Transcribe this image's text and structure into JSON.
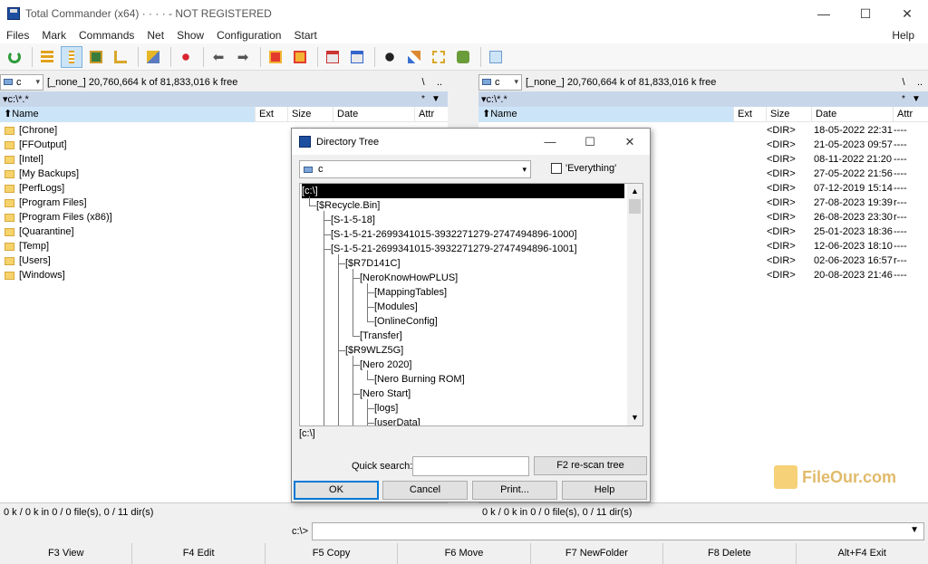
{
  "window": {
    "title": "Total Commander (x64) · · · · - NOT REGISTERED",
    "controls": [
      "—",
      "☐",
      "✕"
    ]
  },
  "menu": [
    "Files",
    "Mark",
    "Commands",
    "Net",
    "Show",
    "Configuration",
    "Start"
  ],
  "menu_help": "Help",
  "toolbar_icons": [
    "refresh-icon",
    "brief-view-icon",
    "full-view-icon",
    "thumbnail-view-icon",
    "tree-view-icon",
    "invert-selection-icon",
    "sort-icon",
    "back-icon",
    "forward-icon",
    "pack-icon",
    "unpack-icon",
    "ftp-icon",
    "url-icon",
    "search-icon",
    "multi-rename-icon",
    "sync-dirs-icon",
    "compare-icon",
    "notepad-icon"
  ],
  "left_panel": {
    "drive": "c",
    "drive_info": "[_none_]  20,760,664 k of 81,833,016 k free",
    "nav_root": "\\",
    "nav_up": "..",
    "path": "▾c:\\*.*",
    "path_star": "*",
    "path_arrow": "▼",
    "columns": {
      "name": "⬆Name",
      "ext": "Ext",
      "size": "Size",
      "date": "Date",
      "attr": "Attr"
    },
    "files": [
      "[Chrone]",
      "[FFOutput]",
      "[Intel]",
      "[My Backups]",
      "[PerfLogs]",
      "[Program Files]",
      "[Program Files (x86)]",
      "[Quarantine]",
      "[Temp]",
      "[Users]",
      "[Windows]"
    ],
    "status": "0 k / 0 k in 0 / 0 file(s), 0 / 11 dir(s)"
  },
  "right_panel": {
    "drive": "c",
    "drive_info": "[_none_]  20,760,664 k of 81,833,016 k free",
    "nav_root": "\\",
    "nav_up": "..",
    "path": "▾c:\\*.*",
    "path_star": "*",
    "path_arrow": "▼",
    "columns": {
      "name": "⬆Name",
      "ext": "Ext",
      "size": "Size",
      "date": "Date",
      "attr": "Attr"
    },
    "files": [
      {
        "size": "<DIR>",
        "date": "18-05-2022 22:31",
        "attr": "----"
      },
      {
        "size": "<DIR>",
        "date": "21-05-2023 09:57",
        "attr": "----"
      },
      {
        "size": "<DIR>",
        "date": "08-11-2022 21:20",
        "attr": "----"
      },
      {
        "size": "<DIR>",
        "date": "27-05-2022 21:56",
        "attr": "----"
      },
      {
        "size": "<DIR>",
        "date": "07-12-2019 15:14",
        "attr": "----"
      },
      {
        "size": "<DIR>",
        "date": "27-08-2023 19:39",
        "attr": "r---"
      },
      {
        "size": "<DIR>",
        "date": "26-08-2023 23:30",
        "attr": "r---"
      },
      {
        "size": "<DIR>",
        "date": "25-01-2023 18:36",
        "attr": "----"
      },
      {
        "size": "<DIR>",
        "date": "12-06-2023 18:10",
        "attr": "----"
      },
      {
        "size": "<DIR>",
        "date": "02-06-2023 16:57",
        "attr": "r---"
      },
      {
        "size": "<DIR>",
        "date": "20-08-2023 21:46",
        "attr": "----"
      }
    ],
    "status": "0 k / 0 k in 0 / 0 file(s), 0 / 11 dir(s)"
  },
  "command_line": {
    "prompt": "c:\\>",
    "value": "",
    "arrow": "▼"
  },
  "function_keys": [
    "F3 View",
    "F4 Edit",
    "F5 Copy",
    "F6 Move",
    "F7 NewFolder",
    "F8 Delete",
    "Alt+F4 Exit"
  ],
  "dialog": {
    "title": "Directory Tree",
    "controls": [
      "—",
      "☐",
      "✕"
    ],
    "drive": "c",
    "everything_label": "'Everything'",
    "tree": [
      {
        "label": "[c:\\]",
        "level": 0
      },
      {
        "label": "[$Recycle.Bin]",
        "level": 1
      },
      {
        "label": "[S-1-5-18]",
        "level": 2
      },
      {
        "label": "[S-1-5-21-2699341015-3932271279-2747494896-1000]",
        "level": 2
      },
      {
        "label": "[S-1-5-21-2699341015-3932271279-2747494896-1001]",
        "level": 2
      },
      {
        "label": "[$R7D141C]",
        "level": 3
      },
      {
        "label": "[NeroKnowHowPLUS]",
        "level": 4
      },
      {
        "label": "[MappingTables]",
        "level": 5
      },
      {
        "label": "[Modules]",
        "level": 5
      },
      {
        "label": "[OnlineConfig]",
        "level": 5
      },
      {
        "label": "[Transfer]",
        "level": 4
      },
      {
        "label": "[$R9WLZ5G]",
        "level": 3
      },
      {
        "label": "[Nero 2020]",
        "level": 4
      },
      {
        "label": "[Nero Burning ROM]",
        "level": 5
      },
      {
        "label": "[Nero Start]",
        "level": 4
      },
      {
        "label": "[logs]",
        "level": 5
      },
      {
        "label": "[userData]",
        "level": 5
      }
    ],
    "current_path": "[c:\\]",
    "quick_search_label": "Quick search:",
    "quick_search_value": "",
    "rescan_button": "F2 re-scan tree",
    "ok_button": "OK",
    "cancel_button": "Cancel",
    "print_button": "Print...",
    "help_button": "Help"
  },
  "watermark": "FileOur.com"
}
